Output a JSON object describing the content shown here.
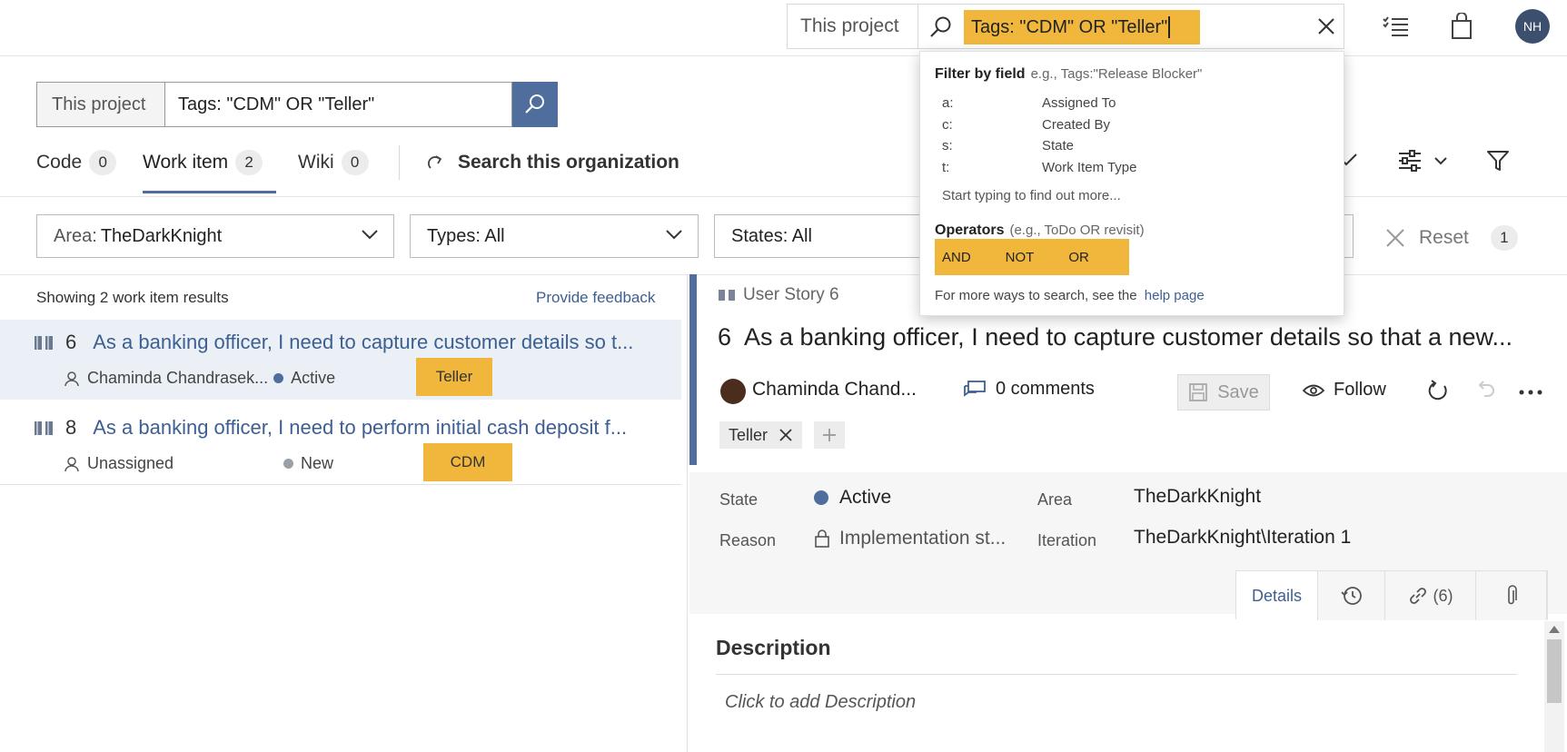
{
  "topbar": {
    "scope": "This project",
    "query": "Tags: \"CDM\" OR \"Teller\"",
    "avatar_initials": "NH",
    "icons": [
      "search-icon",
      "close-icon",
      "task-list-icon",
      "shopping-bag-icon",
      "avatar"
    ]
  },
  "search": {
    "scope": "This project",
    "query": "Tags: \"CDM\" OR \"Teller\""
  },
  "tabs": [
    {
      "label": "Code",
      "count": "0"
    },
    {
      "label": "Work item",
      "count": "2"
    },
    {
      "label": "Wiki",
      "count": "0"
    }
  ],
  "search_org": "Search this organization",
  "filters": {
    "area_label": "Area:",
    "area_value": "TheDarkKnight",
    "types": "Types: All",
    "states": "States: All",
    "reset": "Reset",
    "reset_count": "1"
  },
  "results": {
    "count_text": "Showing 2 work item results",
    "feedback": "Provide feedback",
    "items": [
      {
        "id": "6",
        "title": "As a banking officer, I need to capture customer details so t...",
        "assignee": "Chaminda Chandrasek...",
        "state": "Active",
        "state_color": "#4f6d9d",
        "tag": "Teller"
      },
      {
        "id": "8",
        "title": "As a banking officer, I need to perform initial cash deposit f...",
        "assignee": "Unassigned",
        "state": "New",
        "state_color": "#9aa0a6",
        "tag": "CDM"
      }
    ]
  },
  "workitem": {
    "type_label": "User Story 6",
    "id": "6",
    "title": "As a banking officer, I need to capture customer details so that a new...",
    "assignee": "Chaminda Chand...",
    "comments": "0 comments",
    "save": "Save",
    "follow": "Follow",
    "tag": "Teller",
    "fields": {
      "state_label": "State",
      "state_value": "Active",
      "reason_label": "Reason",
      "reason_value": "Implementation st...",
      "area_label": "Area",
      "area_value": "TheDarkKnight",
      "iteration_label": "Iteration",
      "iteration_value": "TheDarkKnight\\Iteration 1"
    },
    "tabs": {
      "details": "Details",
      "links": "(6)"
    },
    "description_heading": "Description",
    "description_placeholder": "Click to add Description"
  },
  "popup": {
    "filter_title": "Filter by field",
    "filter_hint": "e.g., Tags:\"Release Blocker\"",
    "fields": [
      {
        "key": "a:",
        "label": "Assigned To"
      },
      {
        "key": "c:",
        "label": "Created By"
      },
      {
        "key": "s:",
        "label": "State"
      },
      {
        "key": "t:",
        "label": "Work Item Type"
      }
    ],
    "more": "Start typing to find out more...",
    "operators_title": "Operators",
    "operators_hint": "(e.g., ToDo OR revisit)",
    "operators": [
      "AND",
      "NOT",
      "OR"
    ],
    "footer": "For more ways to search, see the",
    "help_link": "help page"
  },
  "colors": {
    "accent": "#4f6d9d",
    "highlight": "#f0b73c",
    "link": "#3d5f92"
  }
}
